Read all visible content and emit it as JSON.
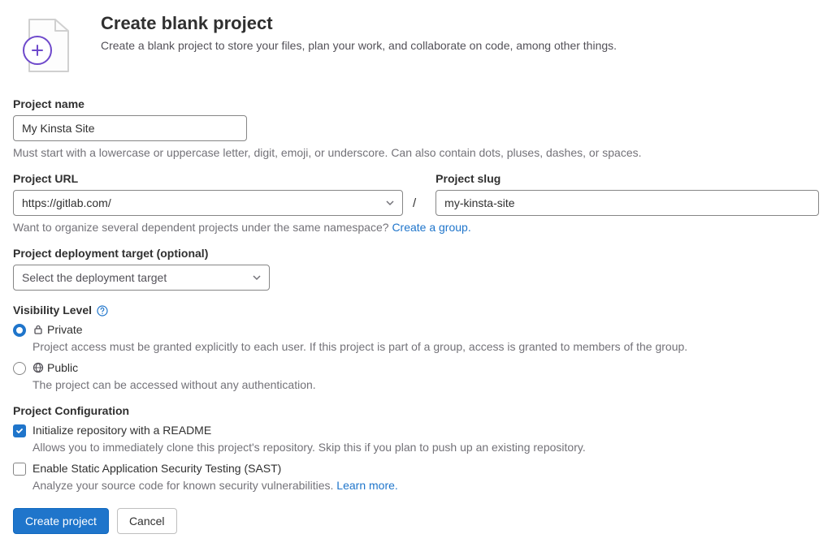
{
  "header": {
    "title": "Create blank project",
    "subtitle": "Create a blank project to store your files, plan your work, and collaborate on code, among other things."
  },
  "project_name": {
    "label": "Project name",
    "value": "My Kinsta Site",
    "help": "Must start with a lowercase or uppercase letter, digit, emoji, or underscore. Can also contain dots, pluses, dashes, or spaces."
  },
  "project_url": {
    "label": "Project URL",
    "value": "https://gitlab.com/",
    "separator": "/"
  },
  "project_slug": {
    "label": "Project slug",
    "value": "my-kinsta-site"
  },
  "group_help": {
    "text": "Want to organize several dependent projects under the same namespace? ",
    "link": "Create a group."
  },
  "deployment": {
    "label": "Project deployment target (optional)",
    "placeholder": "Select the deployment target"
  },
  "visibility": {
    "label": "Visibility Level",
    "options": [
      {
        "name": "Private",
        "desc": "Project access must be granted explicitly to each user. If this project is part of a group, access is granted to members of the group.",
        "checked": true
      },
      {
        "name": "Public",
        "desc": "The project can be accessed without any authentication.",
        "checked": false
      }
    ]
  },
  "configuration": {
    "label": "Project Configuration",
    "options": [
      {
        "name": "Initialize repository with a README",
        "desc": "Allows you to immediately clone this project's repository. Skip this if you plan to push up an existing repository.",
        "checked": true
      },
      {
        "name": "Enable Static Application Security Testing (SAST)",
        "desc": "Analyze your source code for known security vulnerabilities. ",
        "desc_link": "Learn more.",
        "checked": false
      }
    ]
  },
  "buttons": {
    "submit": "Create project",
    "cancel": "Cancel"
  }
}
